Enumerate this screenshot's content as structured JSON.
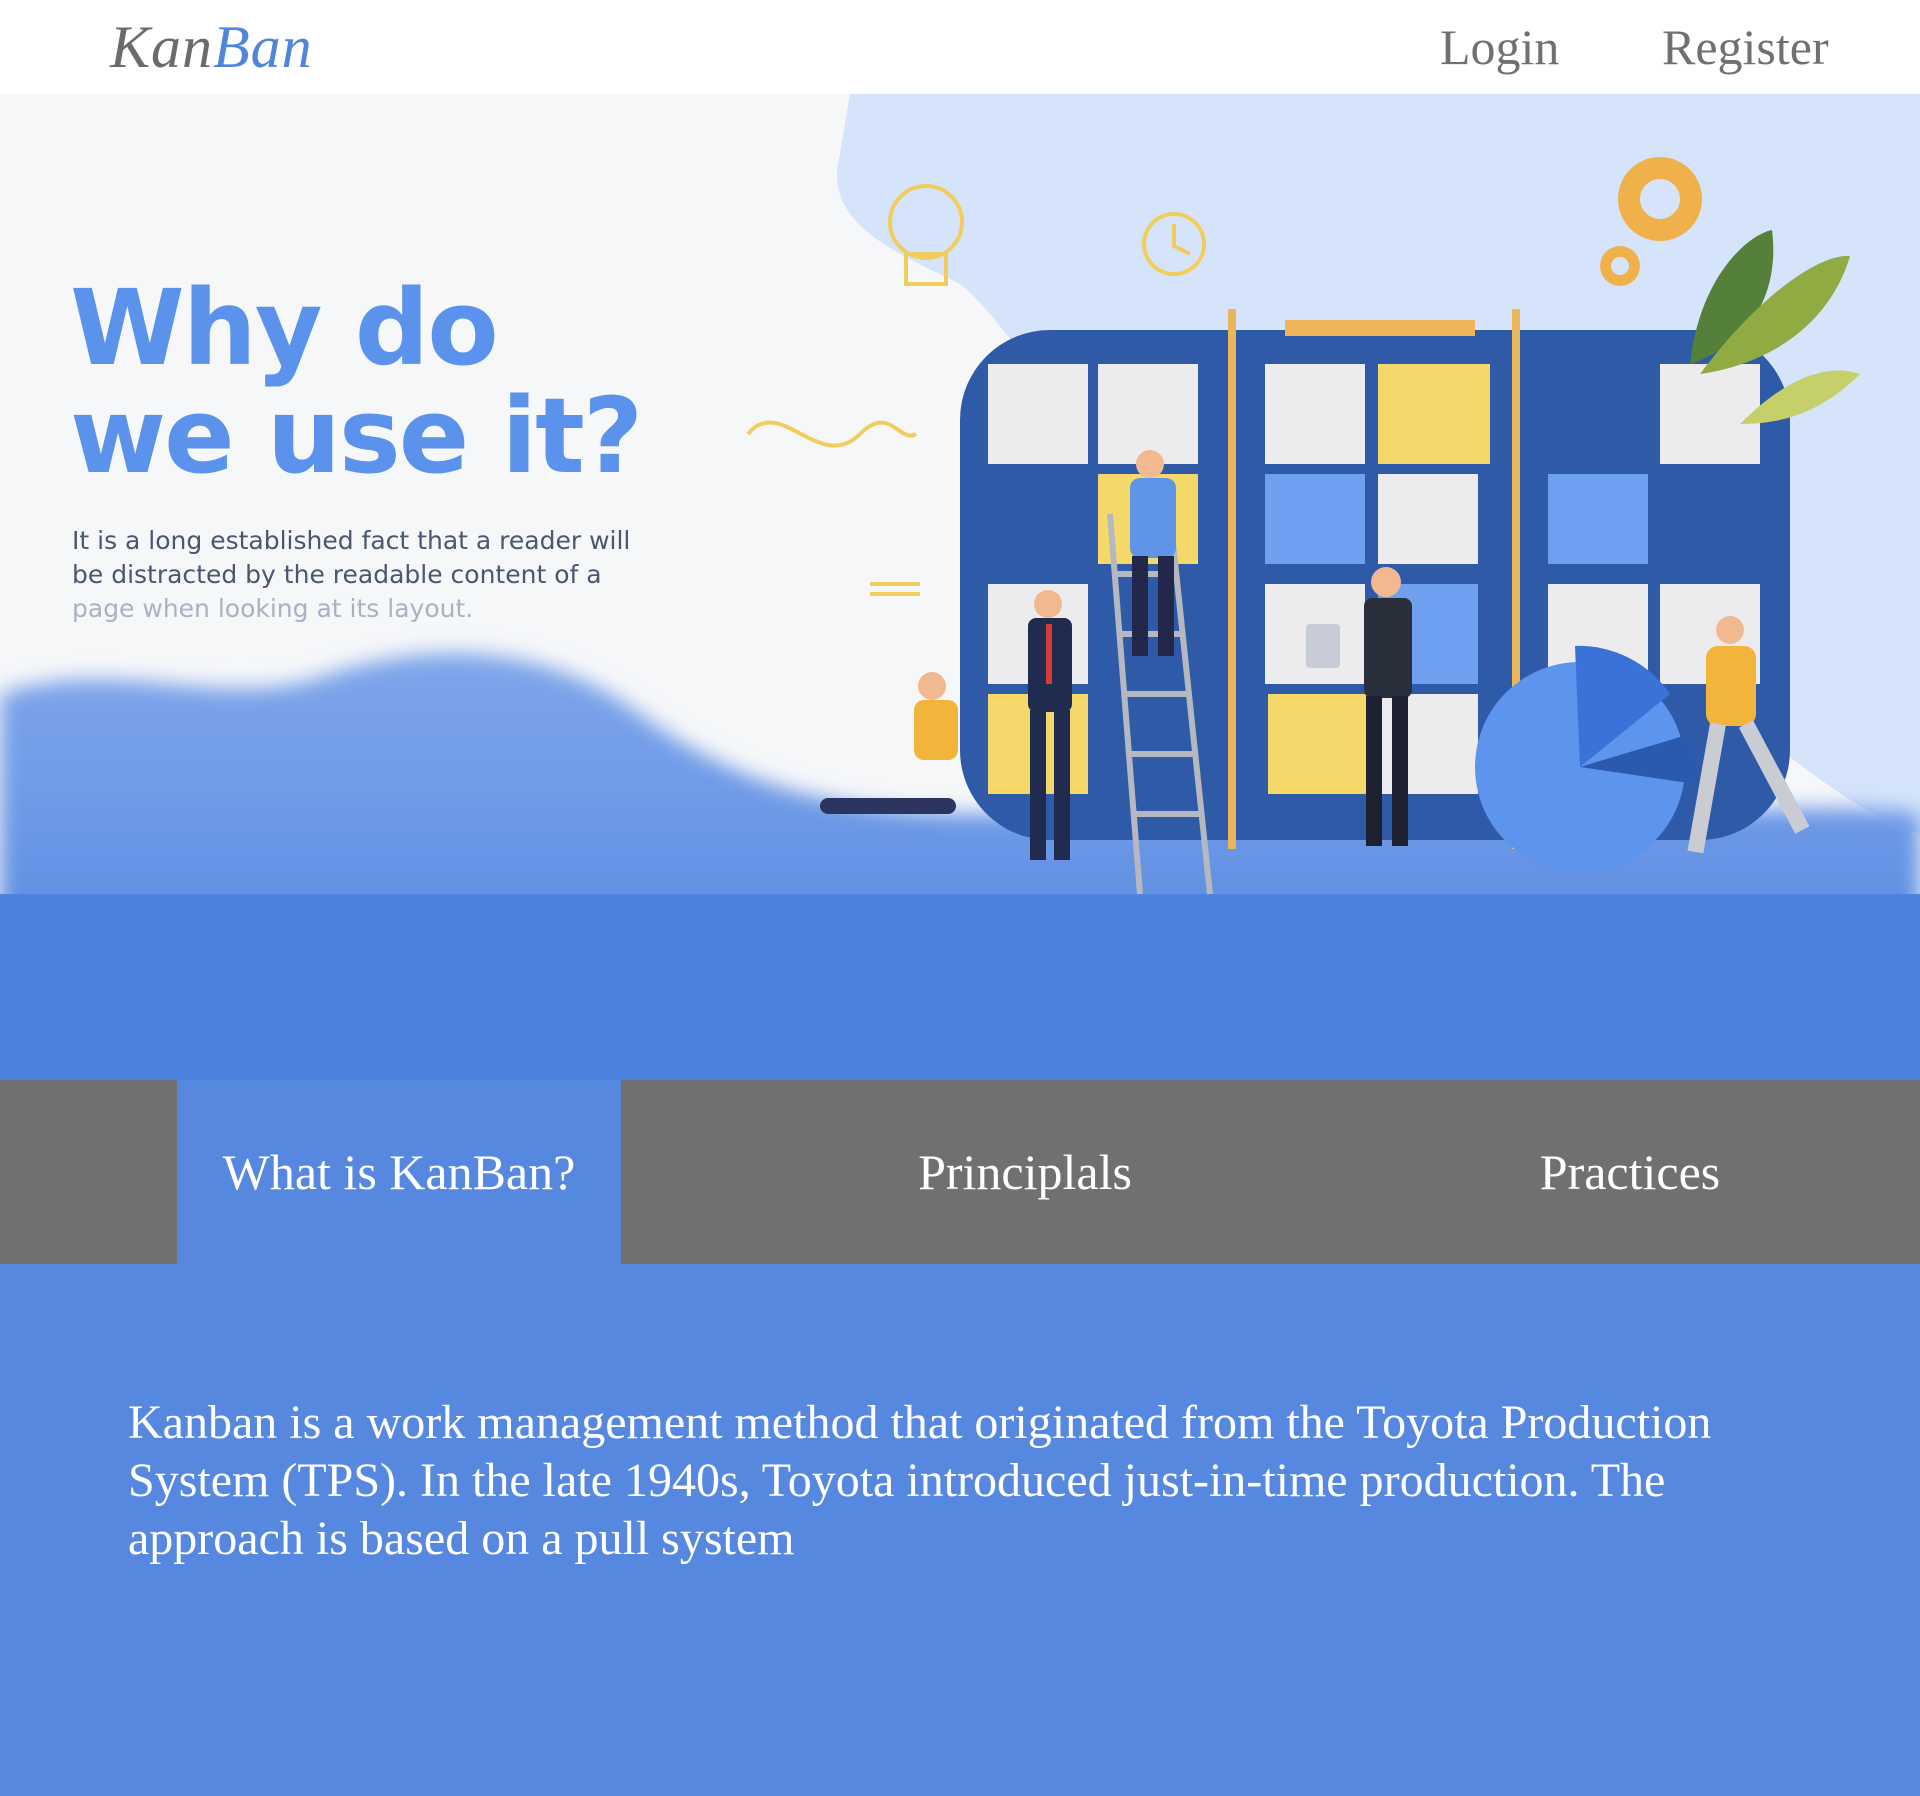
{
  "header": {
    "logo_part1": "Kan",
    "logo_part2": "Ban",
    "login_label": "Login",
    "register_label": "Register"
  },
  "hero": {
    "title": "Why do we use it?",
    "text_main": "It is a long established fact that a reader will be distracted by the readable content of a",
    "text_faded": "page when looking at its layout."
  },
  "tabs": [
    {
      "label": "What is KanBan?",
      "active": true
    },
    {
      "label": "Principlals",
      "active": false
    },
    {
      "label": "Practices",
      "active": false
    }
  ],
  "content": {
    "paragraph": "Kanban is a work management method that originated from the Toyota Production System (TPS). In the late 1940s, Toyota introduced just-in-time production. The approach is based on a pull system"
  },
  "colors": {
    "brand_blue": "#5688e0",
    "tab_gray": "#707070",
    "logo_gray": "#6b6b6b",
    "title_blue": "#5b93ec"
  }
}
